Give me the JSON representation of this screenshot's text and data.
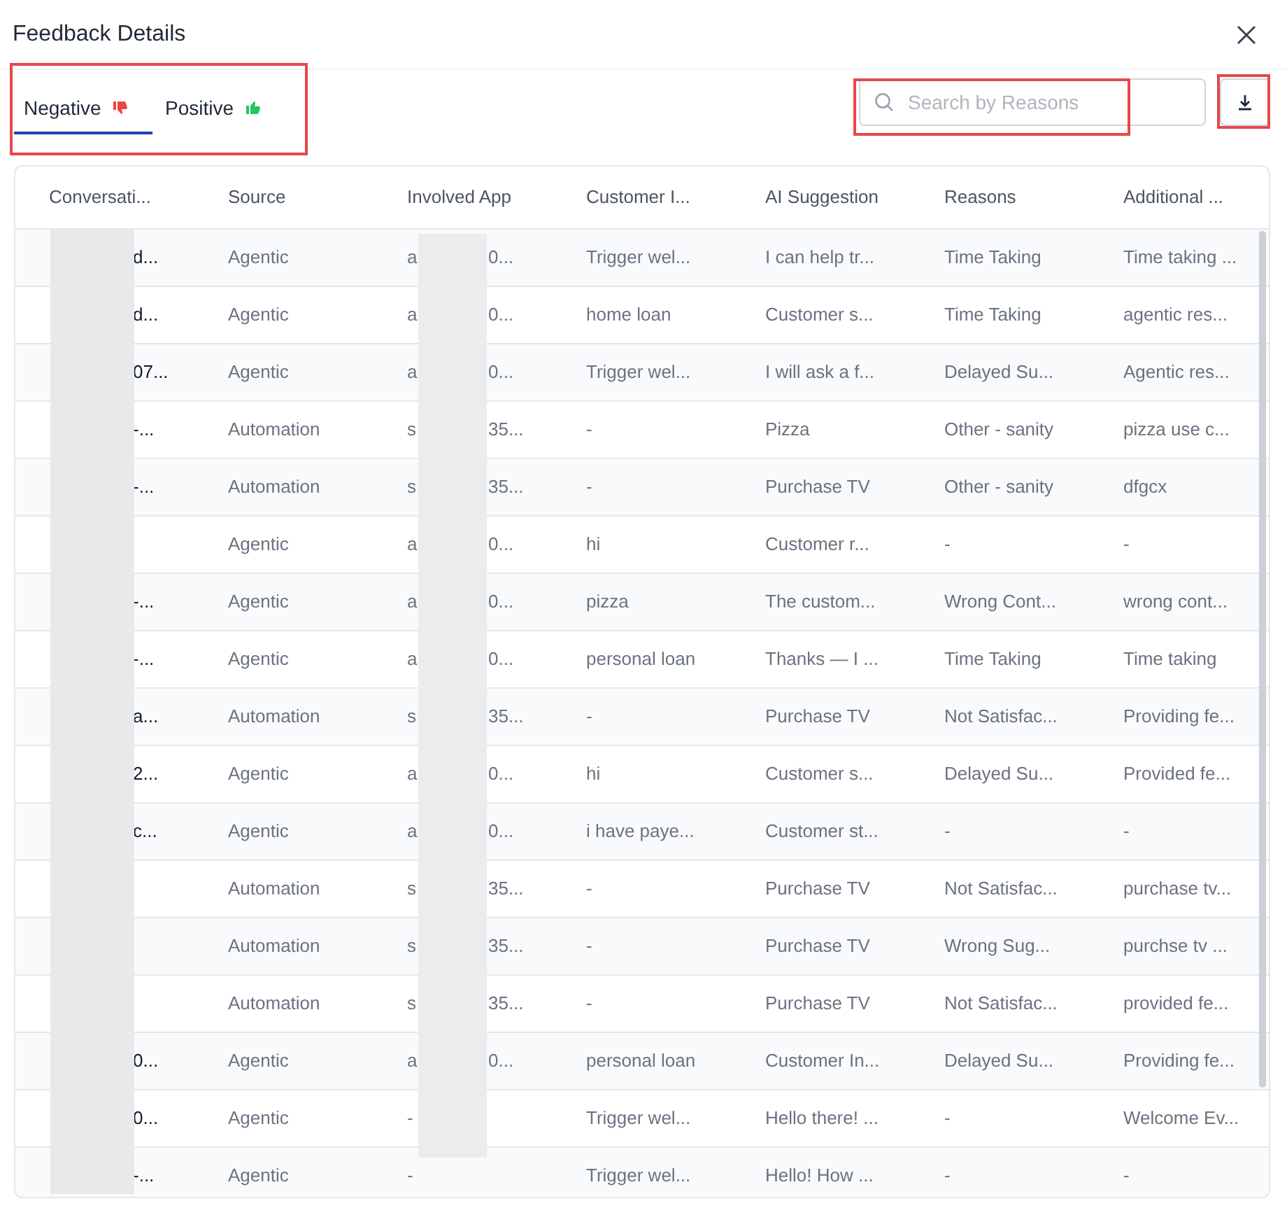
{
  "title": "Feedback Details",
  "tabs": [
    {
      "label": "Negative",
      "kind": "negative",
      "selected": true
    },
    {
      "label": "Positive",
      "kind": "positive",
      "selected": false
    }
  ],
  "search": {
    "placeholder": "Search by Reasons"
  },
  "table": {
    "columns": [
      "Conversati...",
      "Source",
      "Involved App",
      "Customer I...",
      "AI Suggestion",
      "Reasons",
      "Additional ..."
    ],
    "rows": [
      {
        "conversation": "d...",
        "source": "Agentic",
        "app_start": "a",
        "app_end": "0...",
        "customer": "Trigger wel...",
        "suggestion": "I can help tr...",
        "reason": "Time Taking",
        "additional": "Time taking ..."
      },
      {
        "conversation": "d...",
        "source": "Agentic",
        "app_start": "a",
        "app_end": "0...",
        "customer": "home loan",
        "suggestion": "Customer s...",
        "reason": "Time Taking",
        "additional": "agentic res..."
      },
      {
        "conversation": "07...",
        "source": "Agentic",
        "app_start": "a",
        "app_end": "0...",
        "customer": "Trigger wel...",
        "suggestion": "I will ask a f...",
        "reason": "Delayed Su...",
        "additional": "Agentic res..."
      },
      {
        "conversation": "-...",
        "source": "Automation",
        "app_start": "s",
        "app_end": "35...",
        "customer": "-",
        "suggestion": "Pizza",
        "reason": "Other - sanity",
        "additional": "pizza use c..."
      },
      {
        "conversation": "-...",
        "source": "Automation",
        "app_start": "s",
        "app_end": "35...",
        "customer": "-",
        "suggestion": "Purchase TV",
        "reason": "Other - sanity",
        "additional": "dfgcx"
      },
      {
        "source": "Agentic",
        "app_start": "a",
        "app_end": "0...",
        "customer": "hi",
        "suggestion": "Customer r...",
        "reason": "-",
        "additional": "-"
      },
      {
        "conversation": "-...",
        "source": "Agentic",
        "app_start": "a",
        "app_end": "0...",
        "customer": "pizza",
        "suggestion": "The custom...",
        "reason": "Wrong Cont...",
        "additional": "wrong cont..."
      },
      {
        "conversation": "-...",
        "source": "Agentic",
        "app_start": "a",
        "app_end": "0...",
        "customer": "personal loan",
        "suggestion": "Thanks — I ...",
        "reason": "Time Taking",
        "additional": "Time taking"
      },
      {
        "conversation": "a...",
        "source": "Automation",
        "app_start": "s",
        "app_end": "35...",
        "customer": "-",
        "suggestion": "Purchase TV",
        "reason": "Not Satisfac...",
        "additional": "Providing fe..."
      },
      {
        "conversation": "2...",
        "source": "Agentic",
        "app_start": "a",
        "app_end": "0...",
        "customer": "hi",
        "suggestion": "Customer s...",
        "reason": "Delayed Su...",
        "additional": "Provided fe..."
      },
      {
        "conversation": "c...",
        "source": "Agentic",
        "app_start": "a",
        "app_end": "0...",
        "customer": "i have paye...",
        "suggestion": "Customer st...",
        "reason": "-",
        "additional": "-"
      },
      {
        "source": "Automation",
        "app_start": "s",
        "app_end": "35...",
        "customer": "-",
        "suggestion": "Purchase TV",
        "reason": "Not Satisfac...",
        "additional": "purchase tv..."
      },
      {
        "source": "Automation",
        "app_start": "s",
        "app_end": "35...",
        "customer": "-",
        "suggestion": "Purchase TV",
        "reason": "Wrong Sug...",
        "additional": "purchse tv ..."
      },
      {
        "source": "Automation",
        "app_start": "s",
        "app_end": "35...",
        "customer": "-",
        "suggestion": "Purchase TV",
        "reason": "Not Satisfac...",
        "additional": "provided fe..."
      },
      {
        "conversation": "0...",
        "source": "Agentic",
        "app_start": "a",
        "app_end": "0...",
        "customer": "personal loan",
        "suggestion": "Customer In...",
        "reason": "Delayed Su...",
        "additional": "Providing fe..."
      },
      {
        "conversation": "0...",
        "source": "Agentic",
        "app_start": "-",
        "customer": "Trigger wel...",
        "suggestion": "Hello there! ...",
        "reason": "-",
        "additional": "Welcome Ev..."
      },
      {
        "conversation": "-...",
        "source": "Agentic",
        "app_start": "-",
        "customer": "Trigger wel...",
        "suggestion": "Hello! How ...",
        "reason": "-",
        "additional": "-"
      }
    ]
  }
}
